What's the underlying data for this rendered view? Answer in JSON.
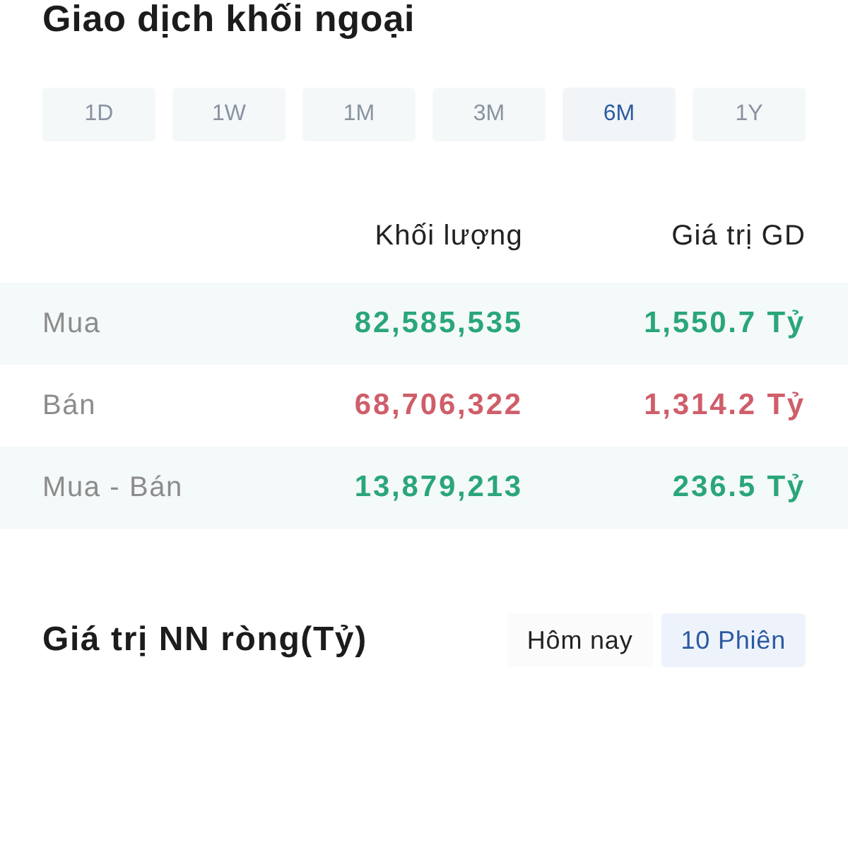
{
  "title": "Giao dịch khối ngoại",
  "periods": [
    {
      "label": "1D",
      "selected": false
    },
    {
      "label": "1W",
      "selected": false
    },
    {
      "label": "1M",
      "selected": false
    },
    {
      "label": "3M",
      "selected": false
    },
    {
      "label": "6M",
      "selected": true
    },
    {
      "label": "1Y",
      "selected": false
    }
  ],
  "table": {
    "columns": [
      "Khối lượng",
      "Giá trị GD"
    ],
    "rows": [
      {
        "label": "Mua",
        "volume": "82,585,535",
        "value": "1,550.7 Tỷ",
        "color": "#2aa67a"
      },
      {
        "label": "Bán",
        "volume": "68,706,322",
        "value": "1,314.2 Tỷ",
        "color": "#cf5e6a"
      },
      {
        "label": "Mua - Bán",
        "volume": "13,879,213",
        "value": "236.5 Tỷ",
        "color": "#2aa67a"
      }
    ]
  },
  "net_value": {
    "title": "Giá trị NN ròng(Tỷ)",
    "ranges": [
      {
        "label": "Hôm nay",
        "selected": false
      },
      {
        "label": "10 Phiên",
        "selected": true
      }
    ]
  }
}
